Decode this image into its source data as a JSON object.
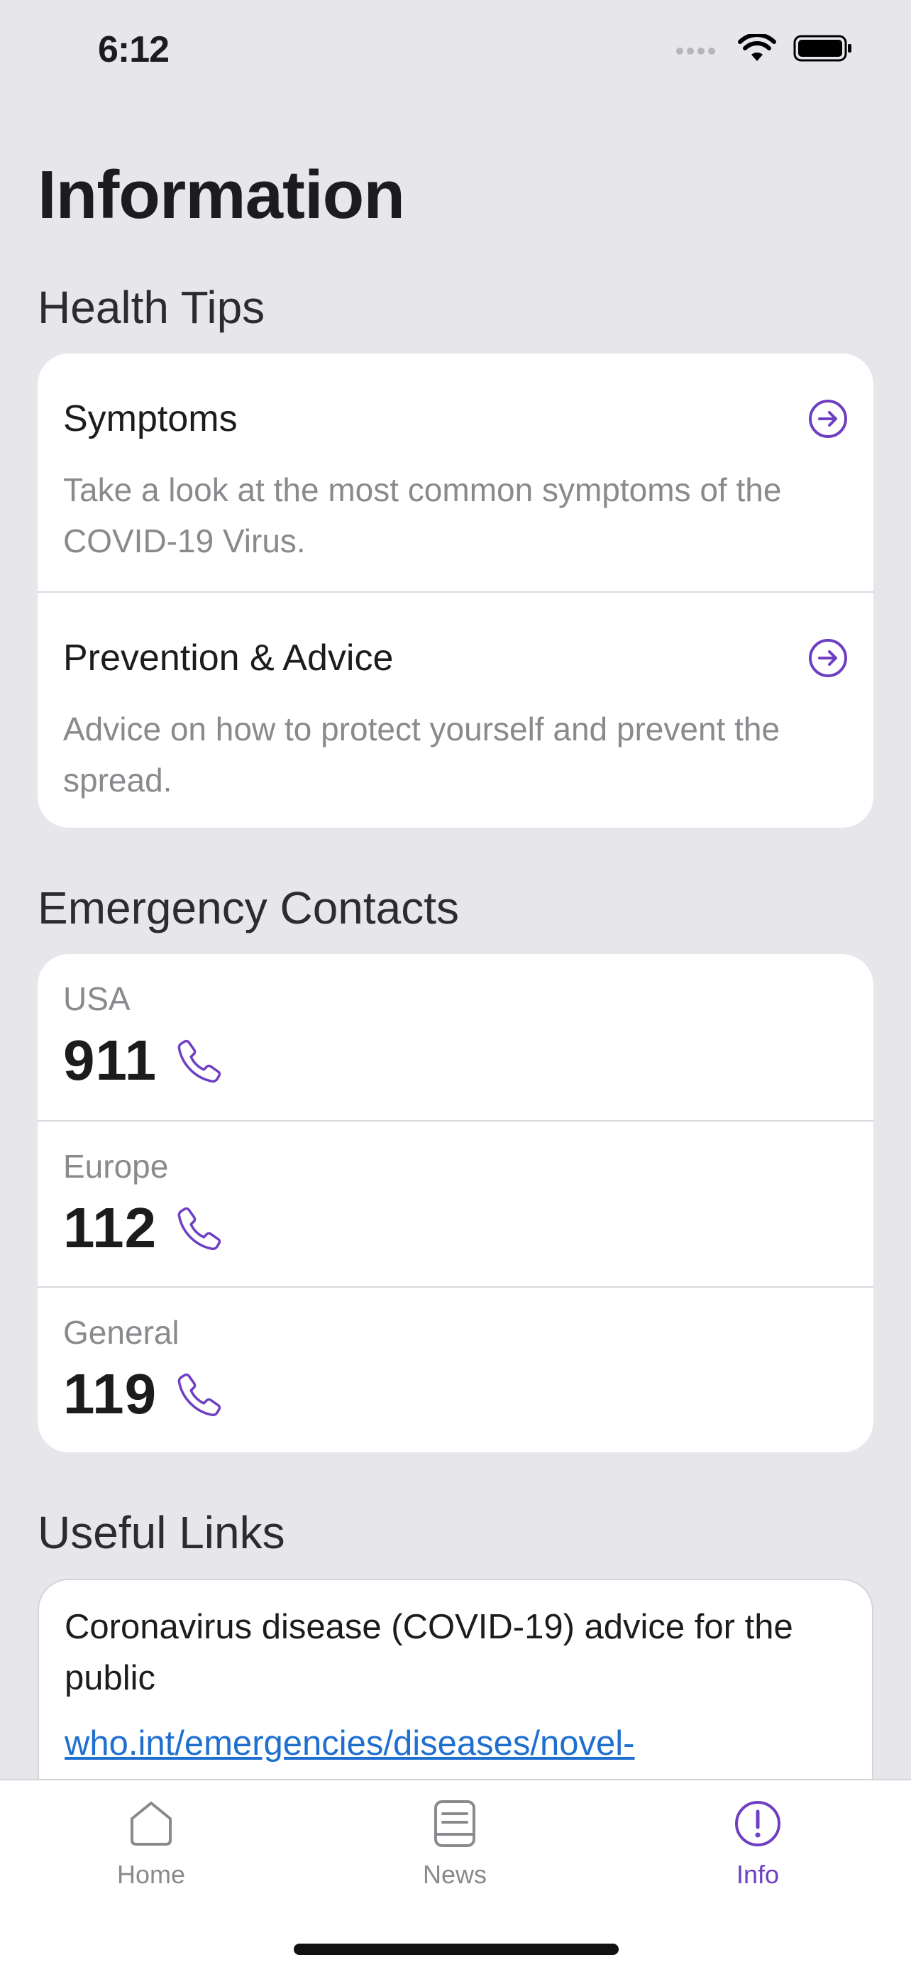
{
  "status_bar": {
    "time": "6:12"
  },
  "page_title": "Information",
  "health_tips": {
    "section_title": "Health Tips",
    "items": [
      {
        "title": "Symptoms",
        "description": "Take a look at the most common symptoms of the COVID-19 Virus.",
        "icon": "arrow-right-circle-icon"
      },
      {
        "title": "Prevention & Advice",
        "description": "Advice on how to protect yourself and prevent the spread.",
        "icon": "arrow-right-circle-icon"
      }
    ]
  },
  "emergency_contacts": {
    "section_title": "Emergency Contacts",
    "items": [
      {
        "region": "USA",
        "number": "911",
        "icon": "phone-icon"
      },
      {
        "region": "Europe",
        "number": "112",
        "icon": "phone-icon"
      },
      {
        "region": "General",
        "number": "119",
        "icon": "phone-icon"
      }
    ]
  },
  "useful_links": {
    "section_title": "Useful Links",
    "items": [
      {
        "title": "Coronavirus disease (COVID-19) advice for the public",
        "url": "who.int/emergencies/diseases/novel-"
      }
    ]
  },
  "tab_bar": {
    "tabs": [
      {
        "label": "Home",
        "icon": "home-icon",
        "active": false
      },
      {
        "label": "News",
        "icon": "news-icon",
        "active": false
      },
      {
        "label": "Info",
        "icon": "info-icon",
        "active": true
      }
    ]
  },
  "colors": {
    "accent": "#6E3FC2",
    "background": "#E6E6EB",
    "link": "#1F6FD0"
  }
}
